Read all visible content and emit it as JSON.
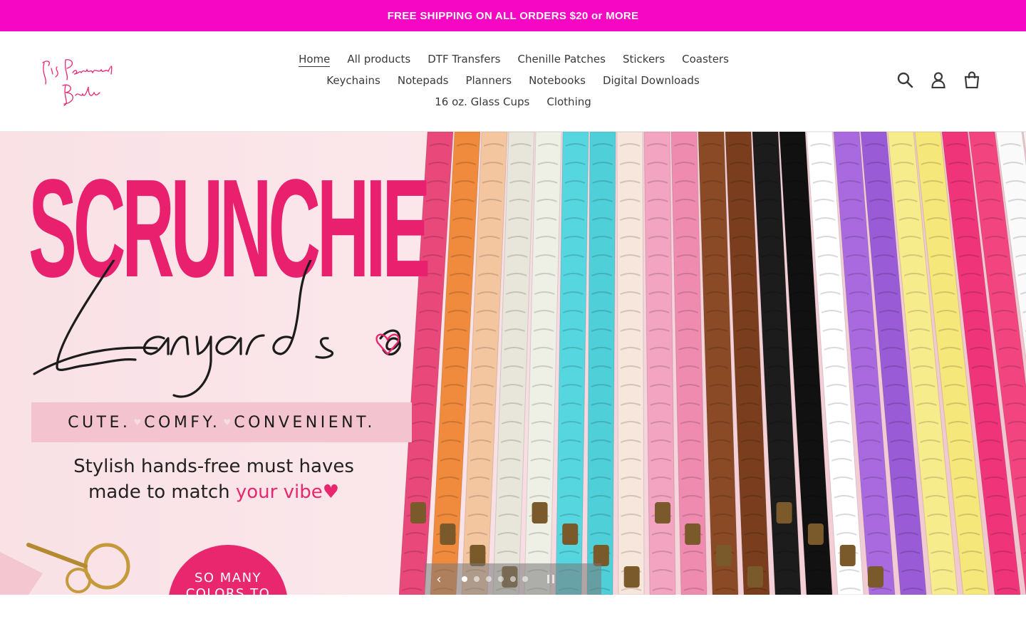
{
  "colors": {
    "announcement_bg": "#f507c3",
    "announcement_text": "#ffffff",
    "accent_pink": "#e8276f",
    "title_pink": "#e8206d"
  },
  "announcement": {
    "text": "FREE SHIPPING ON ALL ORDERS $20 or MORE"
  },
  "header": {
    "logo_text": "It's Personal Babe",
    "nav_row1": [
      "Home",
      "All products",
      "DTF Transfers",
      "Chenille Patches",
      "Stickers",
      "Coasters"
    ],
    "nav_row2": [
      "Keychains",
      "Notepads",
      "Planners",
      "Notebooks",
      "Digital Downloads"
    ],
    "nav_row3": [
      "16 oz. Glass Cups",
      "Clothing"
    ],
    "active_nav": "Home",
    "icons": [
      "search-icon",
      "account-icon",
      "cart-icon"
    ]
  },
  "hero": {
    "title": "SCRUNCHIE",
    "script": "Lanyards",
    "tagline_words": [
      "CUTE.",
      "COMFY.",
      "CONVENIENT."
    ],
    "subtitle_line1": "Stylish hands-free must haves",
    "subtitle_line2_prefix": "made to match ",
    "subtitle_line2_accent": "your vibe",
    "badge_line1": "SO MANY",
    "badge_line2": "COLORS TO"
  },
  "slider": {
    "slide_count": 6,
    "active_slide": 1,
    "prev_icon": "chevron-left-icon",
    "pause_icon": "pause-icon"
  }
}
